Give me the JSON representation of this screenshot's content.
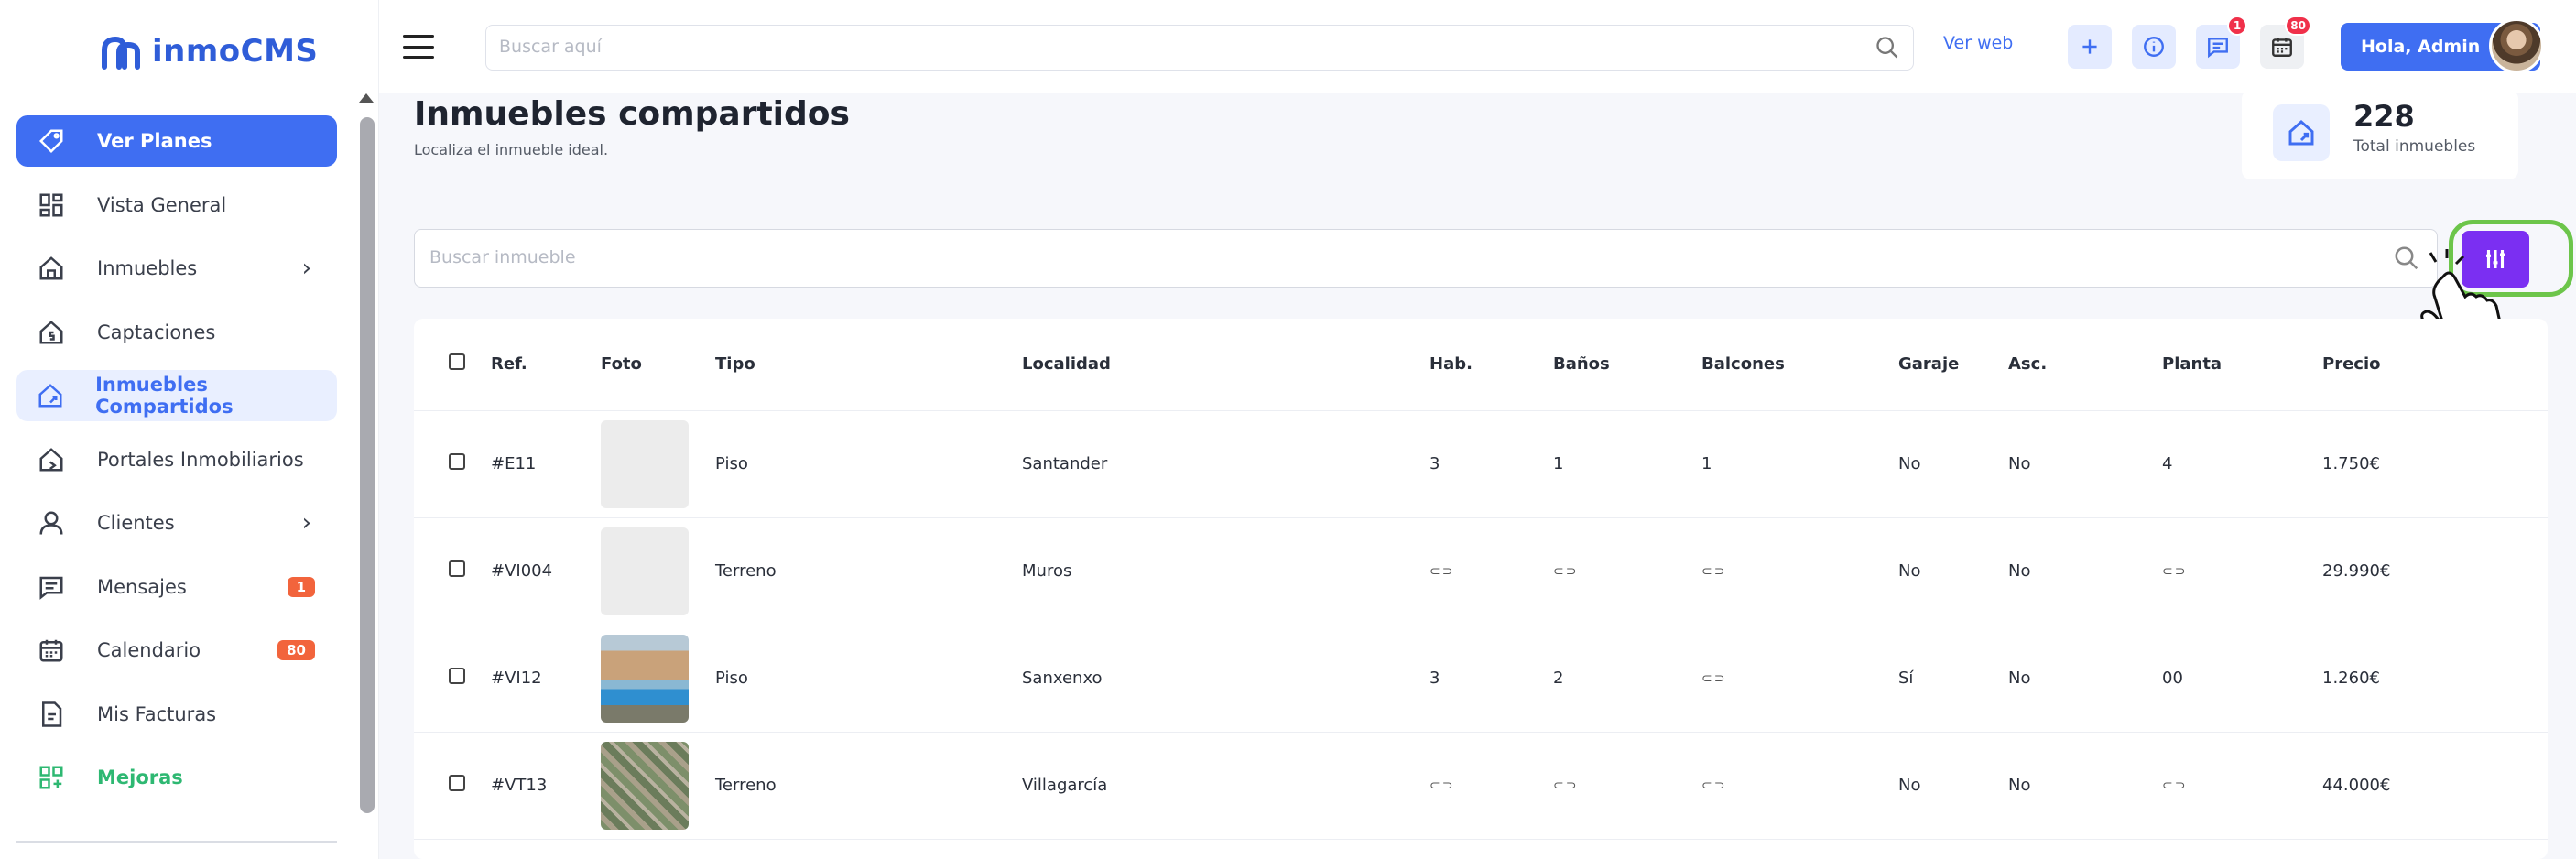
{
  "brand": {
    "name": "inmoCMS"
  },
  "sidebar": {
    "items": [
      {
        "label": "Ver Planes",
        "icon": "tag-icon"
      },
      {
        "label": "Vista General",
        "icon": "dashboard-icon"
      },
      {
        "label": "Inmuebles",
        "icon": "home-icon",
        "chevron": "›"
      },
      {
        "label": "Captaciones",
        "icon": "home-dollar-icon"
      },
      {
        "label": "Inmuebles Compartidos",
        "icon": "home-share-icon"
      },
      {
        "label": "Portales Inmobiliarios",
        "icon": "home-portal-icon"
      },
      {
        "label": "Clientes",
        "icon": "user-icon",
        "chevron": "›"
      },
      {
        "label": "Mensajes",
        "icon": "message-icon",
        "badge": "1"
      },
      {
        "label": "Calendario",
        "icon": "calendar-icon",
        "badge": "80"
      },
      {
        "label": "Mis Facturas",
        "icon": "invoice-icon"
      },
      {
        "label": "Mejoras",
        "icon": "grid-plus-icon"
      }
    ]
  },
  "topbar": {
    "search_placeholder": "Buscar aquí",
    "ver_web": "Ver web",
    "message_badge": "1",
    "calendar_badge": "80",
    "greeting": "Hola, Admin"
  },
  "page": {
    "title": "Inmuebles compartidos",
    "subtitle": "Localiza el inmueble ideal.",
    "stat_value": "228",
    "stat_label": "Total inmuebles",
    "search_placeholder": "Buscar inmueble"
  },
  "table": {
    "headers": [
      "Ref.",
      "Foto",
      "Tipo",
      "Localidad",
      "Hab.",
      "Baños",
      "Balcones",
      "Garaje",
      "Asc.",
      "Planta",
      "Precio"
    ],
    "rows": [
      {
        "ref": "#E11",
        "photo": "placeholder",
        "tipo": "Piso",
        "localidad": "Santander",
        "hab": "3",
        "banos": "1",
        "balcones": "1",
        "garaje": "No",
        "asc": "No",
        "planta": "4",
        "precio": "1.750€"
      },
      {
        "ref": "#VI004",
        "photo": "placeholder",
        "tipo": "Terreno",
        "localidad": "Muros",
        "hab": "⊂⊃",
        "banos": "⊂⊃",
        "balcones": "⊂⊃",
        "garaje": "No",
        "asc": "No",
        "planta": "⊂⊃",
        "precio": "29.990€"
      },
      {
        "ref": "#VI12",
        "photo": "pool",
        "tipo": "Piso",
        "localidad": "Sanxenxo",
        "hab": "3",
        "banos": "2",
        "balcones": "⊂⊃",
        "garaje": "Sí",
        "asc": "No",
        "planta": "00",
        "precio": "1.260€"
      },
      {
        "ref": "#VT13",
        "photo": "aerial",
        "tipo": "Terreno",
        "localidad": "Villagarcía",
        "hab": "⊂⊃",
        "banos": "⊂⊃",
        "balcones": "⊂⊃",
        "garaje": "No",
        "asc": "No",
        "planta": "⊂⊃",
        "precio": "44.000€"
      }
    ]
  },
  "colors": {
    "primary": "#3f6ef2",
    "filter": "#7b2ff2",
    "highlight": "#6cc54a",
    "badge": "#f2643c"
  }
}
